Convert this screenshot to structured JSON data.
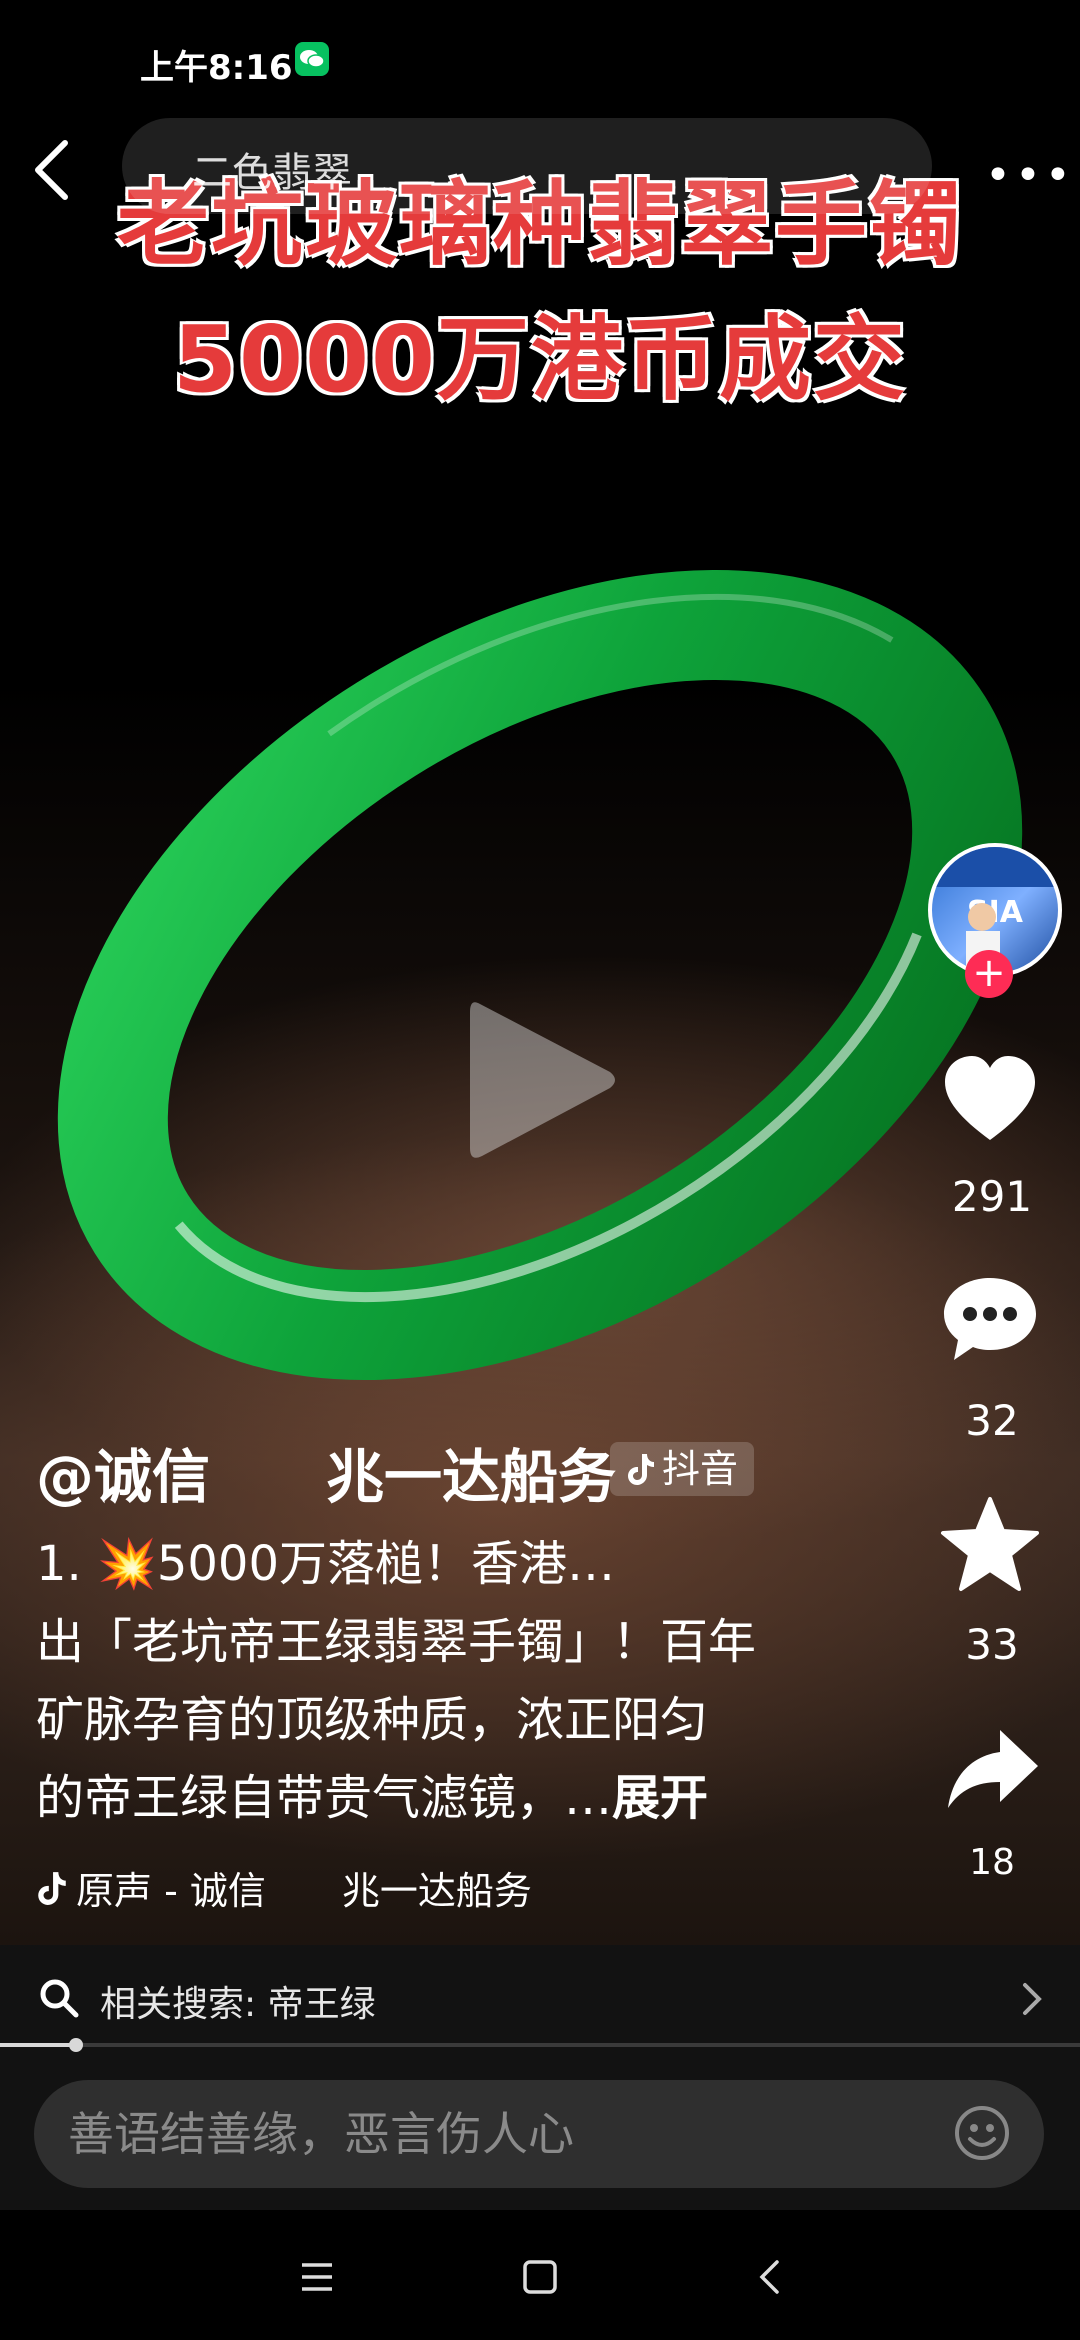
{
  "status_bar": {
    "time": "上午8:16"
  },
  "top_nav": {
    "search_query": "二色翡翠"
  },
  "video_title": {
    "line1": "老坑玻璃种翡翠手镯",
    "line2": "5000万港币成交"
  },
  "right_rail": {
    "likes": "291",
    "comments": "32",
    "favorites": "33",
    "shares": "18"
  },
  "post": {
    "author": "@诚信　　兆一达船务",
    "platform_tag": "抖音",
    "desc_line1": "1. 💥5000万落槌！香港…",
    "desc_line2": "出「老坑帝王绿翡翠手镯」！百年",
    "desc_line3": "矿脉孕育的顶级种质，浓正阳匀",
    "desc_line4": "的帝王绿自带贵气滤镜，…",
    "expand": "展开",
    "music": "原声 - 诚信　　兆一达船务"
  },
  "related_search": {
    "label": "相关搜索: 帝王绿"
  },
  "comment_bar": {
    "placeholder": "善语结善缘，恶言伤人心"
  },
  "video_progress": 0.07,
  "colors": {
    "accent_red": "#fe2c55",
    "title_red": "#e53b3b",
    "jade_green": "#0fa336"
  }
}
